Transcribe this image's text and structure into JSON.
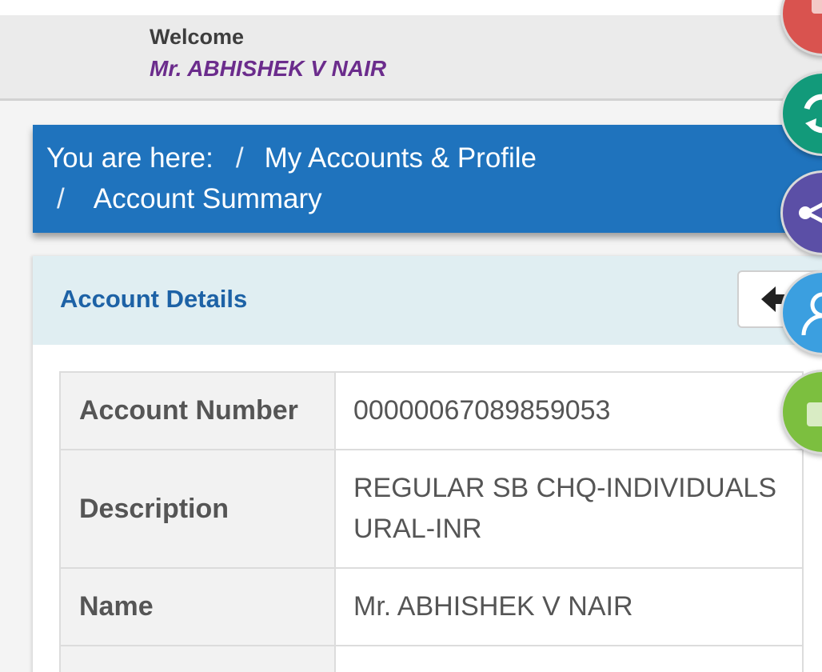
{
  "header": {
    "welcome_label": "Welcome",
    "user_name": "Mr. ABHISHEK V NAIR"
  },
  "breadcrumb": {
    "prefix": "You are here:",
    "separator": "/",
    "items": [
      "My Accounts & Profile",
      "Account Summary"
    ]
  },
  "account_details": {
    "title": "Account Details",
    "rows": [
      {
        "label": "Account Number",
        "value": "00000067089859053"
      },
      {
        "label": "Description",
        "value": "REGULAR SB CHQ-INDIVIDUALS URAL-INR"
      },
      {
        "label": "Name",
        "value": "Mr. ABHISHEK V NAIR"
      },
      {
        "label": "",
        "value": ""
      }
    ]
  },
  "side_icons": [
    "lock-icon",
    "refresh-icon",
    "share-icon",
    "user-icon",
    "wallet-icon"
  ],
  "colors": {
    "breadcrumb_bg": "#1f73bd",
    "user_name": "#6b2c8c",
    "card_title": "#1d62a6",
    "fab_red": "#d9534f",
    "fab_teal": "#129a7a",
    "fab_purple": "#5b4fa6",
    "fab_blue": "#3b9fe0",
    "fab_green": "#7cbf3f"
  }
}
